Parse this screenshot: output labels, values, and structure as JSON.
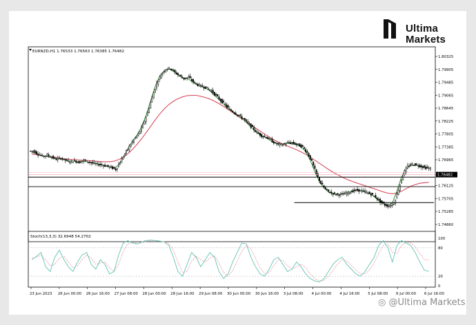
{
  "brand": {
    "line1": "Ultima",
    "line2": "Markets",
    "watermark": "@Ultima Markets"
  },
  "main_panel": {
    "header": "EURNZD,H1  1.76533 1.76563 1.76385 1.76482",
    "price_labels": [
      "1.80325",
      "1.79905",
      "1.79485",
      "1.79065",
      "1.78645",
      "1.78225",
      "1.77805",
      "1.77385",
      "1.76965",
      "1.76125",
      "1.75705",
      "1.75285",
      "1.74860"
    ],
    "current_price": "1.76482"
  },
  "sub_panel": {
    "header": "Stoch(13,3,3) 32.6948 54.2702",
    "levels": [
      "100",
      "80",
      "20",
      "0"
    ]
  },
  "time_axis": [
    "23 Jun 2023",
    "26 Jun 00:00",
    "26 Jun 16:00",
    "27 Jun 08:00",
    "28 Jun 00:00",
    "28 Jun 16:00",
    "29 Jun 08:00",
    "30 Jun 00:00",
    "30 Jun 16:00",
    "3 Jul 08:00",
    "4 Jul 00:00",
    "4 Jul 16:00",
    "5 Jul 08:00",
    "6 Jul 00:00",
    "6 Jul 16:00"
  ],
  "colors": {
    "candle": "#000000",
    "fast_ma": "#2e8b2e",
    "slow_ma": "#d64a5c",
    "stoch_main": "#6fc7b9",
    "stoch_signal": "#e59aa4",
    "level_lines": "#000000"
  },
  "chart_data": {
    "type": "candlestick",
    "symbol": "EURNZD",
    "timeframe": "H1",
    "ohlc_header": {
      "open": 1.76533,
      "high": 1.76563,
      "low": 1.76385,
      "close": 1.76482
    },
    "ylim": [
      1.7486,
      1.80325
    ],
    "close_path": [
      1.7725,
      1.7715,
      1.7708,
      1.7712,
      1.7705,
      1.7698,
      1.7702,
      1.7695,
      1.769,
      1.7693,
      1.7688,
      1.7695,
      1.769,
      1.7685,
      1.7682,
      1.768,
      1.7676,
      1.7672,
      1.7665,
      1.769,
      1.7715,
      1.774,
      1.7762,
      1.778,
      1.781,
      1.785,
      1.79,
      1.7945,
      1.7975,
      1.7992,
      1.7995,
      1.798,
      1.797,
      1.796,
      1.7965,
      1.795,
      1.794,
      1.7935,
      1.793,
      1.792,
      1.7905,
      1.789,
      1.7875,
      1.786,
      1.785,
      1.784,
      1.783,
      1.7815,
      1.78,
      1.7785,
      1.7775,
      1.777,
      1.776,
      1.775,
      1.7745,
      1.7748,
      1.7752,
      1.775,
      1.7745,
      1.7738,
      1.772,
      1.769,
      1.765,
      1.762,
      1.76,
      1.759,
      1.7585,
      1.7583,
      1.7585,
      1.759,
      1.7595,
      1.7598,
      1.7595,
      1.759,
      1.7585,
      1.7575,
      1.756,
      1.755,
      1.7545,
      1.7555,
      1.76,
      1.765,
      1.7675,
      1.7682,
      1.768,
      1.7675,
      1.767,
      1.7668
    ],
    "fast_ma": [
      1.7722,
      1.7716,
      1.771,
      1.7708,
      1.7705,
      1.77,
      1.77,
      1.7697,
      1.7692,
      1.7692,
      1.769,
      1.7692,
      1.769,
      1.7687,
      1.7684,
      1.7681,
      1.7677,
      1.7673,
      1.7668,
      1.768,
      1.7705,
      1.7732,
      1.7756,
      1.7776,
      1.7803,
      1.784,
      1.7888,
      1.7935,
      1.7968,
      1.7986,
      1.7992,
      1.7984,
      1.7974,
      1.7964,
      1.7962,
      1.7952,
      1.7942,
      1.7936,
      1.793,
      1.7921,
      1.7907,
      1.7892,
      1.7878,
      1.7863,
      1.7852,
      1.7842,
      1.7832,
      1.7818,
      1.7803,
      1.7788,
      1.7777,
      1.7771,
      1.7762,
      1.7752,
      1.7747,
      1.7747,
      1.775,
      1.7749,
      1.7745,
      1.7739,
      1.7723,
      1.7695,
      1.7657,
      1.7625,
      1.7604,
      1.7592,
      1.7586,
      1.7584,
      1.7585,
      1.7589,
      1.7594,
      1.7597,
      1.7595,
      1.7591,
      1.7586,
      1.7577,
      1.7563,
      1.7553,
      1.7548,
      1.7556,
      1.7595,
      1.764,
      1.7668,
      1.7678,
      1.7679,
      1.7676,
      1.7672,
      1.7669
    ],
    "slow_ma": [
      1.7715,
      1.7713,
      1.771,
      1.7708,
      1.7706,
      1.7704,
      1.7702,
      1.77,
      1.7698,
      1.7697,
      1.7696,
      1.7695,
      1.7694,
      1.7693,
      1.7692,
      1.7691,
      1.769,
      1.769,
      1.7692,
      1.7697,
      1.7705,
      1.7716,
      1.773,
      1.7746,
      1.7764,
      1.7784,
      1.7805,
      1.7826,
      1.7845,
      1.7862,
      1.7876,
      1.7887,
      1.7895,
      1.7901,
      1.7905,
      1.7906,
      1.7906,
      1.7903,
      1.7899,
      1.7894,
      1.7887,
      1.7879,
      1.787,
      1.786,
      1.785,
      1.784,
      1.783,
      1.782,
      1.781,
      1.78,
      1.779,
      1.778,
      1.7771,
      1.7762,
      1.7754,
      1.7747,
      1.7741,
      1.7735,
      1.7729,
      1.7722,
      1.7714,
      1.7705,
      1.7695,
      1.7685,
      1.7675,
      1.7665,
      1.7656,
      1.7648,
      1.764,
      1.7633,
      1.7627,
      1.7622,
      1.7617,
      1.7612,
      1.7607,
      1.7602,
      1.7597,
      1.7592,
      1.7588,
      1.7586,
      1.7588,
      1.7594,
      1.7602,
      1.761,
      1.7616,
      1.762,
      1.7622,
      1.7623
    ],
    "horizontal_levels": [
      1.764,
      1.7609,
      1.7557
    ],
    "current_price_level": 1.76482,
    "stochastic": {
      "main": [
        55,
        62,
        70,
        40,
        30,
        60,
        75,
        55,
        40,
        30,
        50,
        65,
        70,
        45,
        35,
        55,
        45,
        25,
        30,
        65,
        90,
        95,
        90,
        88,
        92,
        95,
        96,
        95,
        94,
        92,
        85,
        60,
        30,
        20,
        45,
        70,
        60,
        40,
        55,
        70,
        60,
        30,
        15,
        25,
        50,
        70,
        90,
        88,
        60,
        40,
        25,
        20,
        35,
        55,
        60,
        45,
        30,
        35,
        50,
        40,
        25,
        15,
        10,
        8,
        15,
        30,
        45,
        55,
        60,
        45,
        35,
        25,
        20,
        30,
        45,
        60,
        85,
        95,
        80,
        50,
        85,
        95,
        90,
        85,
        70,
        50,
        33,
        30
      ],
      "signal": [
        58,
        60,
        64,
        55,
        42,
        45,
        58,
        62,
        50,
        38,
        42,
        55,
        65,
        58,
        45,
        48,
        50,
        38,
        30,
        45,
        72,
        88,
        92,
        90,
        90,
        93,
        95,
        95,
        94,
        93,
        89,
        75,
        50,
        28,
        30,
        52,
        62,
        55,
        50,
        58,
        63,
        48,
        28,
        20,
        32,
        52,
        72,
        85,
        78,
        58,
        38,
        25,
        28,
        42,
        55,
        53,
        42,
        35,
        40,
        45,
        38,
        25,
        15,
        10,
        11,
        20,
        33,
        45,
        55,
        52,
        43,
        33,
        25,
        25,
        33,
        48,
        68,
        85,
        88,
        70,
        68,
        85,
        92,
        90,
        82,
        68,
        55,
        54
      ]
    }
  }
}
